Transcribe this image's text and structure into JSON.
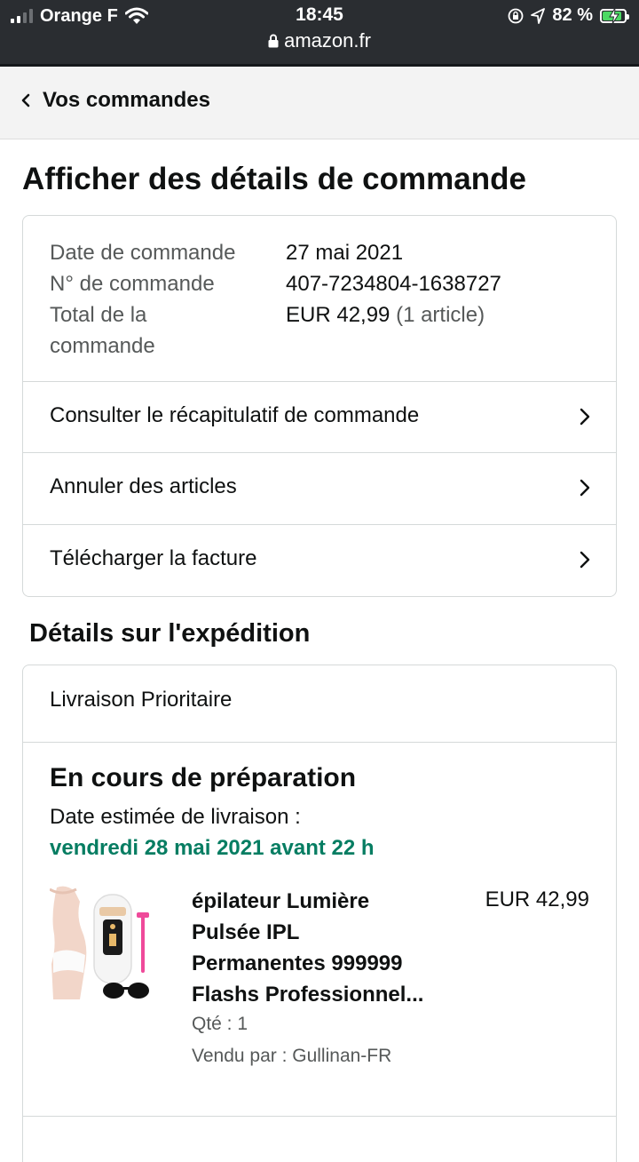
{
  "status_bar": {
    "carrier": "Orange F",
    "time": "18:45",
    "url": "amazon.fr",
    "battery": "82 %"
  },
  "nav": {
    "back_label": "Vos commandes"
  },
  "page_title": "Afficher des détails de commande",
  "order": {
    "date_label": "Date de commande",
    "date_value": "27 mai 2021",
    "number_label": "N° de commande",
    "number_value": "407-7234804-1638727",
    "total_label_1": "Total de la",
    "total_label_2": "commande",
    "total_value": "EUR 42,99",
    "total_count": "(1 article)"
  },
  "links": {
    "summary": "Consulter le récapitulatif de commande",
    "cancel": "Annuler des articles",
    "invoice": "Télécharger la facture"
  },
  "shipping": {
    "section_title": "Détails sur l'expédition",
    "method": "Livraison Prioritaire",
    "status": "En cours de préparation",
    "est_label": "Date estimée de livraison :",
    "est_date": "vendredi 28 mai 2021 avant 22 h",
    "product": {
      "title_1": "épilateur Lumière",
      "title_2": "Pulsée IPL",
      "title_3": "Permanentes 999999",
      "title_4": "Flashs Professionnel...",
      "price": "EUR 42,99",
      "qty": "Qté : 1",
      "seller": "Vendu par : Gullinan-FR"
    }
  },
  "colors": {
    "accent_green": "#067d62",
    "battery_green": "#4cd964"
  }
}
